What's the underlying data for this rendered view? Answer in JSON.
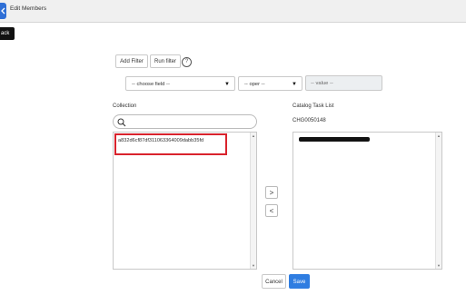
{
  "header": {
    "title": "Edit Members",
    "back_tooltip": "ack"
  },
  "filter": {
    "add_filter": "Add Filter",
    "run_filter": "Run filter",
    "help": "?",
    "field_placeholder": "-- choose field --",
    "operator_placeholder": "-- oper --",
    "value_placeholder": "-- value --",
    "dropdown_icon": "▼"
  },
  "collection": {
    "label": "Collection",
    "item": "a832d6cf87df31106336400​9dabb35fd",
    "highlight_color": "#d9232d"
  },
  "target": {
    "label": "Catalog Task List",
    "record": "CHG0050148"
  },
  "buttons": {
    "move_right": ">",
    "move_left": "<",
    "cancel": "Cancel",
    "save": "Save"
  }
}
